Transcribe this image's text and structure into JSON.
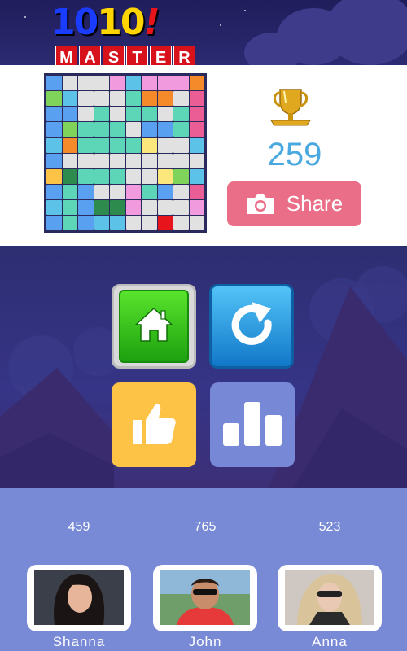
{
  "logo": {
    "digits1": "10",
    "digits2": "10",
    "bang": "!",
    "sub_letters": [
      "M",
      "A",
      "S",
      "T",
      "E",
      "R"
    ]
  },
  "colors": {
    "accent_score": "#4aaadf",
    "share": "#ea6e88",
    "home": "#2fc21b",
    "replay": "#2a9be4",
    "rate": "#fdc346",
    "leaderboard": "#7788d6",
    "friends_bg": "#7889d6"
  },
  "result": {
    "score": "259",
    "share_label": "Share",
    "board": [
      [
        "#5aa0f0",
        "#e1e1e1",
        "#e1e1e1",
        "#e1e1e1",
        "#f29ade",
        "#5cc2e8",
        "#f29ade",
        "#f29ade",
        "#f29ade",
        "#f58a2b"
      ],
      [
        "#7fd25a",
        "#5cc2e8",
        "#e1e1e1",
        "#e1e1e1",
        "#e1e1e1",
        "#5cd6b6",
        "#f58a2b",
        "#f58a2b",
        "#e1e1e1",
        "#ea5e95"
      ],
      [
        "#5aa0f0",
        "#5aa0f0",
        "#e1e1e1",
        "#5cd6b6",
        "#e1e1e1",
        "#5cd6b6",
        "#5cd6b6",
        "#e1e1e1",
        "#5cd6b6",
        "#ea5e95"
      ],
      [
        "#5aa0f0",
        "#7fd25a",
        "#5cd6b6",
        "#5cd6b6",
        "#5cd6b6",
        "#e1e1e1",
        "#5aa0f0",
        "#5aa0f0",
        "#5cd6b6",
        "#ea5e95"
      ],
      [
        "#5cc2e8",
        "#f58a2b",
        "#5cd6b6",
        "#5cd6b6",
        "#5cd6b6",
        "#5cd6b6",
        "#fbe77c",
        "#e1e1e1",
        "#e1e1e1",
        "#5cc2e8"
      ],
      [
        "#5aa0f0",
        "#e1e1e1",
        "#e1e1e1",
        "#e1e1e1",
        "#e1e1e1",
        "#e1e1e1",
        "#e1e1e1",
        "#e1e1e1",
        "#e1e1e1",
        "#e1e1e1"
      ],
      [
        "#fdc346",
        "#2e8b4e",
        "#5cd6b6",
        "#5cd6b6",
        "#5cd6b6",
        "#e1e1e1",
        "#e1e1e1",
        "#fbe77c",
        "#7fd25a",
        "#5cc2e8"
      ],
      [
        "#5aa0f0",
        "#5cd6b6",
        "#5aa0f0",
        "#e1e1e1",
        "#e1e1e1",
        "#f29ade",
        "#5cd6b6",
        "#5aa0f0",
        "#e1e1e1",
        "#ea5e95"
      ],
      [
        "#5cc2e8",
        "#5cd6b6",
        "#5aa0f0",
        "#2e8b4e",
        "#2e8b4e",
        "#f29ade",
        "#e1e1e1",
        "#e1e1e1",
        "#e1e1e1",
        "#f29ade"
      ],
      [
        "#5aa0f0",
        "#5cd6b6",
        "#5aa0f0",
        "#5cc2e8",
        "#5cc2e8",
        "#e1e1e1",
        "#e1e1e1",
        "#e8141c",
        "#e1e1e1",
        "#e1e1e1"
      ]
    ]
  },
  "icons": {
    "trophy": "trophy-icon",
    "camera": "camera-icon",
    "home": "home-icon",
    "replay": "replay-icon",
    "rate": "thumbs-up-icon",
    "leaderboard": "bar-chart-icon"
  },
  "friends": [
    {
      "name": "Shanna",
      "score": "459"
    },
    {
      "name": "John",
      "score": "765"
    },
    {
      "name": "Anna",
      "score": "523"
    }
  ]
}
